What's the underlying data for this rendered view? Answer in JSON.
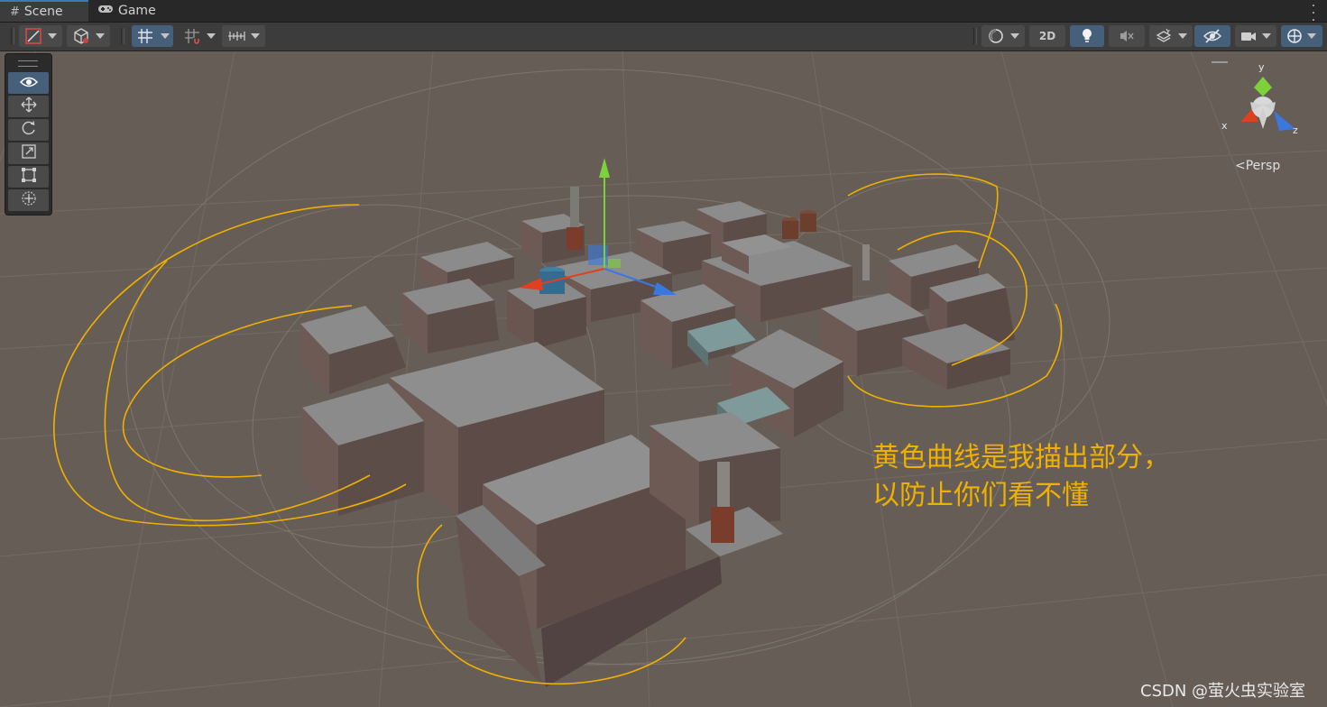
{
  "tabs": {
    "scene": {
      "icon": "#",
      "label": "Scene"
    },
    "game": {
      "icon": "gamepad-icon",
      "label": "Game"
    }
  },
  "toolbar": {
    "toggle_2d": "2D"
  },
  "scene_view": {
    "projection_label": "<Persp",
    "gizmo_axes": {
      "x": "x",
      "y": "y",
      "z": "z"
    },
    "annotation_line1": "黄色曲线是我描出部分，",
    "annotation_line2": "以防止你们看不懂",
    "watermark": "CSDN @萤火虫实验室"
  },
  "colors": {
    "scene_bg": "#655d56",
    "annotation": "#f0b000",
    "axis_x": "#e0401e",
    "axis_y": "#7dd23a",
    "axis_z": "#3a78e0"
  }
}
